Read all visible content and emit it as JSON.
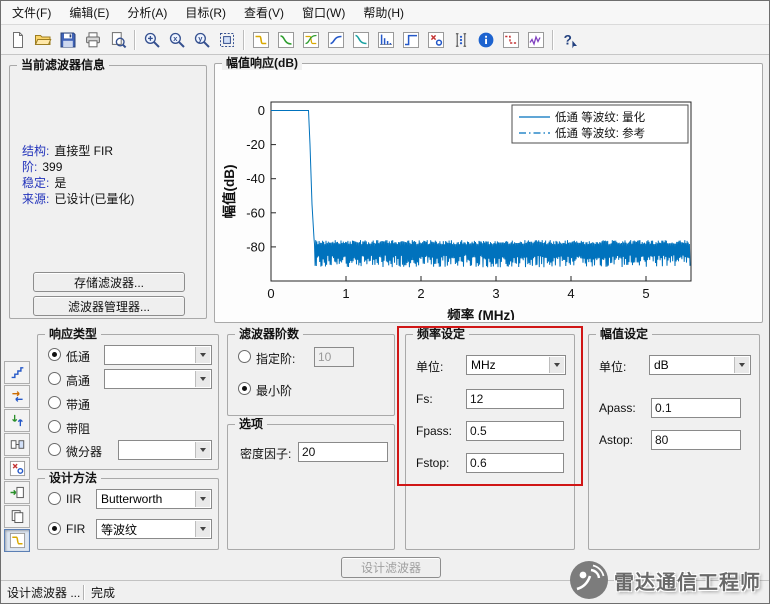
{
  "menu": {
    "items": [
      {
        "name": "menu-file",
        "label": "文件(F)"
      },
      {
        "name": "menu-edit",
        "label": "编辑(E)"
      },
      {
        "name": "menu-analysis",
        "label": "分析(A)"
      },
      {
        "name": "menu-targets",
        "label": "目标(R)"
      },
      {
        "name": "menu-view",
        "label": "查看(V)"
      },
      {
        "name": "menu-window",
        "label": "窗口(W)"
      },
      {
        "name": "menu-help",
        "label": "帮助(H)"
      }
    ]
  },
  "toolbar": {
    "buttons": [
      "new-icon",
      "open-icon",
      "save-icon",
      "print-icon",
      "print-preview-icon",
      "separator",
      "zoom-in-icon",
      "zoom-x-icon",
      "zoom-y-icon",
      "full-view-icon",
      "separator",
      "magnitude-response-icon",
      "phase-response-icon",
      "mag-phase-response-icon",
      "group-delay-icon",
      "phase-delay-icon",
      "impulse-response-icon",
      "step-response-icon",
      "pole-zero-icon",
      "coefficients-icon",
      "filter-info-icon",
      "spec-mask-icon",
      "round-off-noise-icon",
      "separator",
      "help-icon"
    ]
  },
  "sidebar": {
    "buttons": [
      {
        "name": "set-quantization-icon",
        "active": false
      },
      {
        "name": "transform-filter-icon",
        "active": false
      },
      {
        "name": "multirate-filter-icon",
        "active": false
      },
      {
        "name": "realize-model-icon",
        "active": false
      },
      {
        "name": "pole-zero-editor-icon",
        "active": false
      },
      {
        "name": "import-filter-icon",
        "active": false
      },
      {
        "name": "filter-manager-icon",
        "active": false
      },
      {
        "name": "design-filter-icon",
        "active": true
      }
    ]
  },
  "filter_info": {
    "title": "当前滤波器信息",
    "rows": [
      {
        "label": "结构:",
        "value": "直接型 FIR"
      },
      {
        "label": "阶:",
        "value": "399"
      },
      {
        "label": "稳定:",
        "value": "是"
      },
      {
        "label": "来源:",
        "value": "已设计(已量化)"
      }
    ],
    "store_button": "存储滤波器...",
    "manager_button": "滤波器管理器..."
  },
  "plot_panel": {
    "title": "幅值响应(dB)"
  },
  "chart_data": {
    "type": "line",
    "title": "幅值响应(dB)",
    "xlabel": "频率 (MHz)",
    "ylabel": "幅值(dB)",
    "xlim": [
      0,
      5.6
    ],
    "ylim": [
      -100,
      5
    ],
    "xticks": [
      0,
      1,
      2,
      3,
      4,
      5
    ],
    "yticks": [
      0,
      -20,
      -40,
      -60,
      -80
    ],
    "grid": false,
    "legend_position": "top-right",
    "legend": [
      "低通 等波纹: 量化",
      "低通 等波纹: 参考"
    ],
    "series": [
      {
        "name": "低通 等波纹: 量化",
        "style": "solid",
        "color": "#0072BD",
        "response": {
          "fpass": 0.5,
          "fstop": 0.6,
          "apass": 0,
          "astop": -80,
          "stopband_ripple_top": -76,
          "stopband_ripple_bottom": -92
        }
      },
      {
        "name": "低通 等波纹: 参考",
        "style": "dash-dot",
        "color": "#0072BD",
        "response": {
          "fpass": 0.5,
          "fstop": 0.6,
          "apass": 0,
          "astop": -80
        }
      }
    ]
  },
  "response_type": {
    "title": "响应类型",
    "options": [
      {
        "label": "低通",
        "selected": true,
        "dropdown": true,
        "value": ""
      },
      {
        "label": "高通",
        "selected": false,
        "dropdown": true,
        "value": ""
      },
      {
        "label": "带通",
        "selected": false
      },
      {
        "label": "带阻",
        "selected": false
      },
      {
        "label": "微分器",
        "selected": false,
        "dropdown": true,
        "value": ""
      }
    ]
  },
  "design_method": {
    "title": "设计方法",
    "iir": {
      "label": "IIR",
      "selected": false,
      "value": "Butterworth"
    },
    "fir": {
      "label": "FIR",
      "selected": true,
      "value": "等波纹"
    }
  },
  "filter_order": {
    "title": "滤波器阶数",
    "specify": {
      "label": "指定阶:",
      "selected": false,
      "value": "10"
    },
    "minimum": {
      "label": "最小阶",
      "selected": true
    }
  },
  "options_panel": {
    "title": "选项",
    "density_label": "密度因子:",
    "density_value": "20"
  },
  "freq_spec": {
    "title": "频率设定",
    "unit_label": "单位:",
    "unit_value": "MHz",
    "fs_label": "Fs:",
    "fs_value": "12",
    "fpass_label": "Fpass:",
    "fpass_value": "0.5",
    "fstop_label": "Fstop:",
    "fstop_value": "0.6"
  },
  "mag_spec": {
    "title": "幅值设定",
    "unit_label": "单位:",
    "unit_value": "dB",
    "apass_label": "Apass:",
    "apass_value": "0.1",
    "astop_label": "Astop:",
    "astop_value": "80"
  },
  "design_button_label": "设计滤波器",
  "statusbar": {
    "left": "设计滤波器 ...",
    "right": "完成"
  },
  "watermark": {
    "text": "雷达通信工程师"
  },
  "colors": {
    "accent_blue": "#0072BD",
    "highlight_red": "#d01616",
    "info_label_blue": "#2233bb"
  }
}
